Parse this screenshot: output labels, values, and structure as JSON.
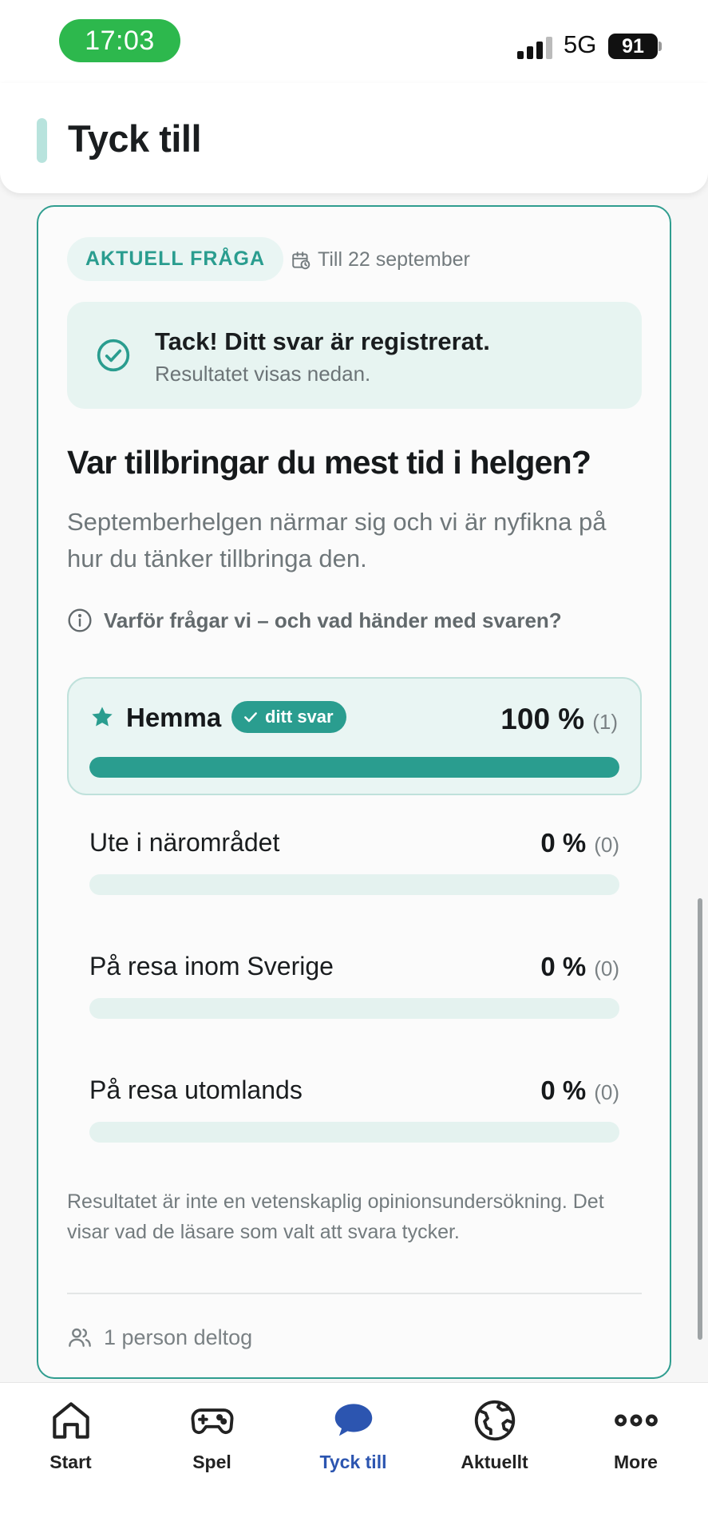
{
  "status_bar": {
    "time": "17:03",
    "network": "5G",
    "battery": "91"
  },
  "header": {
    "title": "Tyck till"
  },
  "poll": {
    "badge": "AKTUELL FRÅGA",
    "deadline": "Till 22 september",
    "confirmation": {
      "title": "Tack! Ditt svar är registrerat.",
      "subtitle": "Resultatet visas nedan."
    },
    "question": "Var tillbringar du mest tid i helgen?",
    "description": "Septemberhelgen närmar sig och vi är nyfikna på hur du tänker tillbringa den.",
    "info_link": "Varför frågar vi – och vad händer med svaren?",
    "your_answer_label": "ditt svar",
    "options": [
      {
        "label": "Hemma",
        "percent": "100 %",
        "count": "(1)",
        "fraction": 1.0,
        "selected": true
      },
      {
        "label": "Ute i närområdet",
        "percent": "0 %",
        "count": "(0)",
        "fraction": 0.0,
        "selected": false
      },
      {
        "label": "På resa inom Sverige",
        "percent": "0 %",
        "count": "(0)",
        "fraction": 0.0,
        "selected": false
      },
      {
        "label": "På resa utomlands",
        "percent": "0 %",
        "count": "(0)",
        "fraction": 0.0,
        "selected": false
      }
    ],
    "disclaimer": "Resultatet är inte en vetenskaplig opinionsundersökning. Det visar vad de läsare som valt att svara tycker.",
    "participants": "1 person deltog"
  },
  "nav": {
    "items": [
      {
        "label": "Start",
        "icon": "home-icon"
      },
      {
        "label": "Spel",
        "icon": "gamepad-icon"
      },
      {
        "label": "Tyck till",
        "icon": "chat-bubble-icon"
      },
      {
        "label": "Aktuellt",
        "icon": "globe-icon"
      },
      {
        "label": "More",
        "icon": "more-dots-icon"
      }
    ]
  },
  "colors": {
    "accent": "#2a9d8f",
    "nav_active": "#2c55b0",
    "time_pill": "#2db84d"
  }
}
